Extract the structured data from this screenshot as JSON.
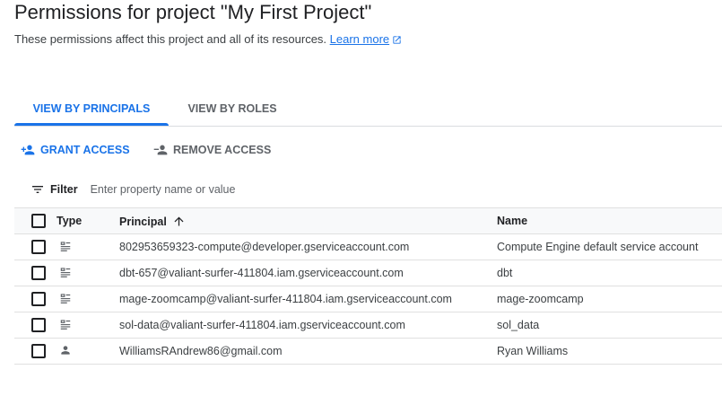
{
  "page": {
    "title": "Permissions for project \"My First Project\"",
    "subtitle": "These permissions affect this project and all of its resources.",
    "learn_more": "Learn more"
  },
  "tabs": [
    {
      "label": "VIEW BY PRINCIPALS",
      "active": true
    },
    {
      "label": "VIEW BY ROLES",
      "active": false
    }
  ],
  "actions": {
    "grant": "GRANT ACCESS",
    "remove": "REMOVE ACCESS"
  },
  "filter": {
    "label": "Filter",
    "placeholder": "Enter property name or value"
  },
  "table": {
    "headers": {
      "type": "Type",
      "principal": "Principal",
      "name": "Name"
    },
    "sort": {
      "column": "principal",
      "direction": "ascending"
    },
    "rows": [
      {
        "type": "service-account",
        "principal": "802953659323-compute@developer.gserviceaccount.com",
        "name": "Compute Engine default service account"
      },
      {
        "type": "service-account",
        "principal": "dbt-657@valiant-surfer-411804.iam.gserviceaccount.com",
        "name": "dbt"
      },
      {
        "type": "service-account",
        "principal": "mage-zoomcamp@valiant-surfer-411804.iam.gserviceaccount.com",
        "name": "mage-zoomcamp"
      },
      {
        "type": "service-account",
        "principal": "sol-data@valiant-surfer-411804.iam.gserviceaccount.com",
        "name": "sol_data"
      },
      {
        "type": "user",
        "principal": "WilliamsRAndrew86@gmail.com",
        "name": "Ryan Williams"
      }
    ]
  },
  "colors": {
    "accent": "#1a73e8",
    "text": "#202124",
    "muted": "#5f6368"
  }
}
